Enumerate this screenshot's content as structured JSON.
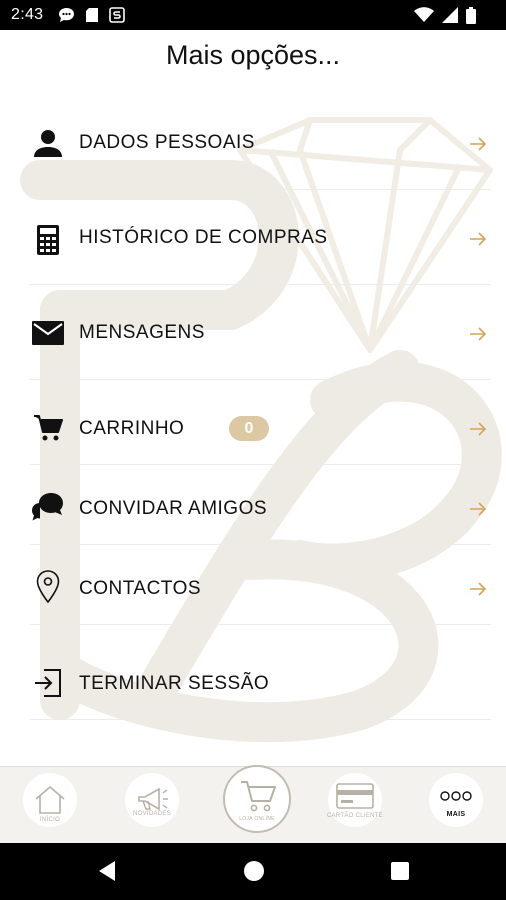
{
  "status_bar": {
    "time": "2:43",
    "left_icons": [
      "chat-bubble-icon",
      "sd-card-icon",
      "s-logo-icon"
    ],
    "right_icons": [
      "wifi-icon",
      "cell-signal-icon",
      "battery-icon"
    ]
  },
  "page": {
    "title": "Mais opções..."
  },
  "menu": {
    "items": [
      {
        "label": "DADOS PESSOAIS",
        "icon": "person-icon"
      },
      {
        "label": "HISTÓRICO DE COMPRAS",
        "icon": "calculator-icon"
      },
      {
        "label": "MENSAGENS",
        "icon": "envelope-icon"
      },
      {
        "label": "CARRINHO",
        "icon": "cart-icon",
        "badge": "0"
      },
      {
        "label": "CONVIDAR AMIGOS",
        "icon": "chat-bubbles-icon"
      },
      {
        "label": "CONTACTOS",
        "icon": "location-pin-icon"
      },
      {
        "label": "TERMINAR SESSÃO",
        "icon": "logout-icon"
      }
    ]
  },
  "tab_bar": {
    "tabs": [
      {
        "label": "INÍCIO",
        "icon": "home-icon"
      },
      {
        "label": "NOVIDADES",
        "icon": "megaphone-icon"
      },
      {
        "label": "LOJA ONLINE",
        "icon": "cart-icon"
      },
      {
        "label": "CARTÃO CLIENTE",
        "icon": "card-icon"
      },
      {
        "label": "MAIS",
        "icon": "more-icon"
      }
    ]
  },
  "colors": {
    "accent": "#d4a45a",
    "badge": "#dcc9a3",
    "tab_bar_bg": "#f4f2ee",
    "watermark": "#efece6"
  }
}
